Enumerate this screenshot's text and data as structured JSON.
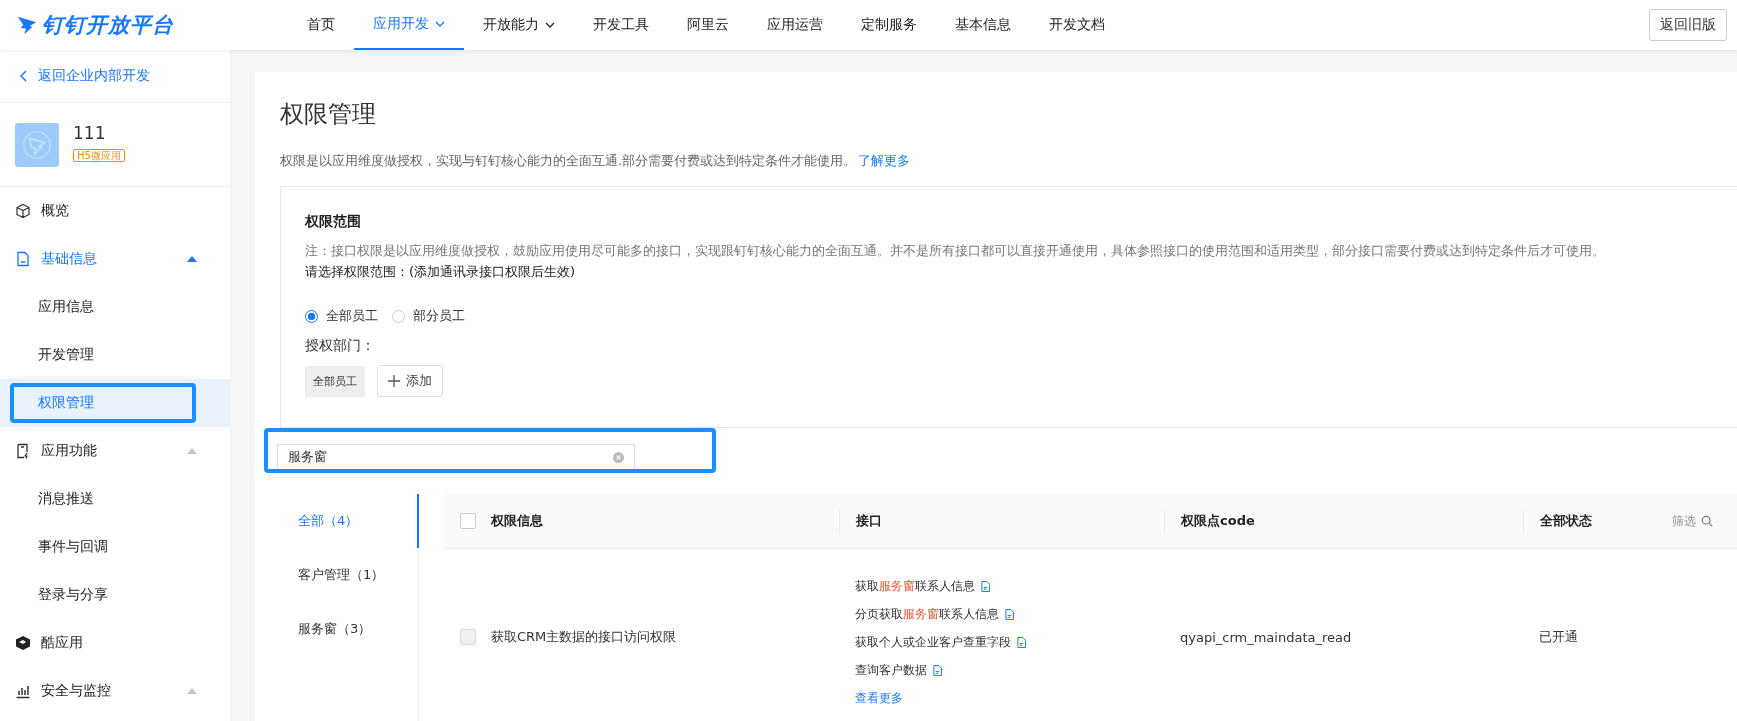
{
  "nav": {
    "logo": "钉钉开放平台",
    "items": [
      {
        "label": "首页",
        "selected": false,
        "dropdown": false
      },
      {
        "label": "应用开发",
        "selected": true,
        "dropdown": true
      },
      {
        "label": "开放能力",
        "selected": false,
        "dropdown": true
      },
      {
        "label": "开发工具",
        "selected": false,
        "dropdown": false
      },
      {
        "label": "阿里云",
        "selected": false,
        "dropdown": false
      },
      {
        "label": "应用运营",
        "selected": false,
        "dropdown": false
      },
      {
        "label": "定制服务",
        "selected": false,
        "dropdown": false
      },
      {
        "label": "基本信息",
        "selected": false,
        "dropdown": false
      },
      {
        "label": "开发文档",
        "selected": false,
        "dropdown": false
      }
    ],
    "back_button": "返回旧版"
  },
  "sidebar": {
    "back_link": "返回企业内部开发",
    "app": {
      "name": "111",
      "tag": "H5微应用"
    },
    "items": [
      {
        "label": "概览",
        "selected": false
      },
      {
        "label": "基础信息",
        "expanded": true,
        "children": [
          {
            "label": "应用信息",
            "selected": false,
            "highlighted": false
          },
          {
            "label": "开发管理",
            "selected": false,
            "highlighted": false
          },
          {
            "label": "权限管理",
            "selected": true,
            "highlighted": true
          }
        ]
      },
      {
        "label": "应用功能",
        "expanded": true,
        "children": [
          {
            "label": "消息推送",
            "selected": false,
            "highlighted": false
          },
          {
            "label": "事件与回调",
            "selected": false,
            "highlighted": false
          },
          {
            "label": "登录与分享",
            "selected": false,
            "highlighted": false
          }
        ]
      },
      {
        "label": "酷应用",
        "selected": false
      },
      {
        "label": "安全与监控",
        "expanded": true
      }
    ]
  },
  "page": {
    "title": "权限管理",
    "intro": "权限是以应用维度做授权，实现与钉钉核心能力的全面互通.部分需要付费或达到特定条件才能使用。",
    "intro_link": "了解更多",
    "scope": {
      "title": "权限范围",
      "note": "注：接口权限是以应用维度做授权，鼓励应用使用尽可能多的接口，实现跟钉钉核心能力的全面互通。并不是所有接口都可以直接开通使用，具体参照接口的使用范围和适用类型，部分接口需要付费或达到特定条件后才可使用。",
      "prompt": "请选择权限范围：(添加通讯录接口权限后生效)",
      "radios": [
        {
          "label": "全部员工",
          "selected": true
        },
        {
          "label": "部分员工",
          "selected": false
        }
      ],
      "dept_label": "授权部门：",
      "dept_tags": [
        "全部员工"
      ],
      "add_button": "添加"
    },
    "search": {
      "value": "服务窗",
      "highlighted": true
    },
    "categories": [
      {
        "label": "全部（4）",
        "selected": true
      },
      {
        "label": "客户管理（1）",
        "selected": false
      },
      {
        "label": "服务窗（3）",
        "selected": false
      }
    ],
    "table": {
      "select_all_checked": false,
      "columns": [
        "权限信息",
        "接口",
        "权限点code",
        "全部状态"
      ],
      "filter": "筛选",
      "rows": [
        {
          "checked": false,
          "disabled": true,
          "name": "获取CRM主数据的接口访问权限",
          "apis": [
            {
              "parts": [
                {
                  "text": "获取",
                  "match": false
                },
                {
                  "text": "服务窗",
                  "match": true
                },
                {
                  "text": "联系人信息",
                  "match": false
                }
              ]
            },
            {
              "parts": [
                {
                  "text": "分页获取",
                  "match": false
                },
                {
                  "text": "服务窗",
                  "match": true
                },
                {
                  "text": "联系人信息",
                  "match": false
                }
              ]
            },
            {
              "parts": [
                {
                  "text": "获取个人或企业客户查重字段",
                  "match": false
                }
              ]
            },
            {
              "parts": [
                {
                  "text": "查询客户数据",
                  "match": false
                }
              ]
            }
          ],
          "more": "查看更多",
          "code": "qyapi_crm_maindata_read",
          "status": "已开通"
        }
      ]
    }
  }
}
